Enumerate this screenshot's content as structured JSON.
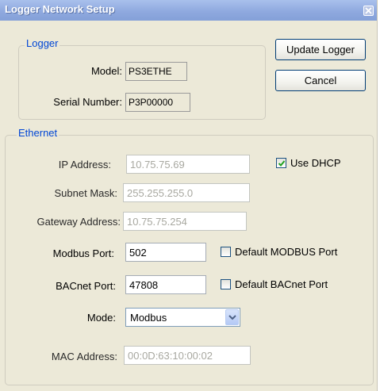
{
  "window": {
    "title": "Logger Network Setup",
    "close_glyph": "✕"
  },
  "buttons": {
    "update_logger": "Update Logger",
    "cancel": "Cancel"
  },
  "logger": {
    "legend": "Logger",
    "model_label": "Model:",
    "model_value": "PS3ETHE",
    "serial_label": "Serial Number:",
    "serial_value": "P3P00000"
  },
  "ethernet": {
    "legend": "Ethernet",
    "ip_label": "IP Address:",
    "ip_value": "10.75.75.69",
    "use_dhcp_label": "Use DHCP",
    "use_dhcp_checked": true,
    "subnet_label": "Subnet Mask:",
    "subnet_value": "255.255.255.0",
    "gateway_label": "Gateway Address:",
    "gateway_value": "10.75.75.254",
    "modbus_port_label": "Modbus Port:",
    "modbus_port_value": "502",
    "default_modbus_label": "Default MODBUS Port",
    "default_modbus_checked": false,
    "bacnet_port_label": "BACnet Port:",
    "bacnet_port_value": "47808",
    "default_bacnet_label": "Default BACnet Port",
    "default_bacnet_checked": false,
    "mode_label": "Mode:",
    "mode_value": "Modbus",
    "mac_label": "MAC Address:",
    "mac_value": "00:0D:63:10:00:02"
  },
  "icons": {
    "close": "close-icon",
    "checkmark": "checkmark-icon",
    "dropdown": "chevron-down-icon"
  },
  "colors": {
    "titlebar": "#8fa9df",
    "legend_text": "#0046d5",
    "dialog_bg": "#ece9d8",
    "button_border": "#003c74",
    "checkmark": "#21a121"
  }
}
